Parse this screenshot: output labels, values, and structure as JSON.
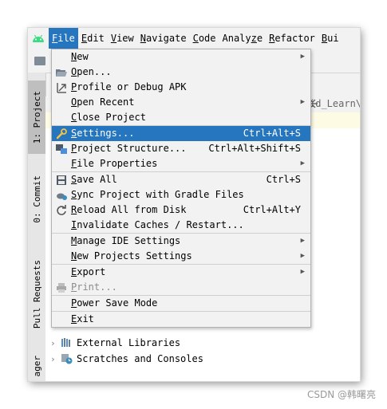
{
  "menubar": {
    "items": [
      {
        "label": "File",
        "mnemonic_index": 0
      },
      {
        "label": "Edit",
        "mnemonic_index": 0
      },
      {
        "label": "View",
        "mnemonic_index": 0
      },
      {
        "label": "Navigate",
        "mnemonic_index": 0
      },
      {
        "label": "Code",
        "mnemonic_index": 0
      },
      {
        "label": "Analyze",
        "mnemonic_index": 5
      },
      {
        "label": "Refactor",
        "mnemonic_index": 0
      },
      {
        "label": "Bui",
        "mnemonic_index": 0
      }
    ]
  },
  "toolstrip": {
    "project_tab": "1: Project",
    "commit_tab": "0: Commit",
    "pull_requests_tab": "Pull Requests",
    "manager_tab": "ager"
  },
  "pathbar": {
    "tail": "id_Learn\\"
  },
  "file_menu": {
    "groups": [
      [
        {
          "label": "New",
          "icon": "",
          "shortcut": "",
          "submenu": true
        },
        {
          "label": "Open...",
          "icon": "folder-open-icon",
          "shortcut": "",
          "submenu": false
        },
        {
          "label": "Profile or Debug APK",
          "icon": "apk-arrow-icon",
          "shortcut": "",
          "submenu": false
        },
        {
          "label": "Open Recent",
          "icon": "",
          "shortcut": "",
          "submenu": true
        },
        {
          "label": "Close Project",
          "icon": "",
          "shortcut": "",
          "submenu": false
        }
      ],
      [
        {
          "label": "Settings...",
          "icon": "wrench-icon",
          "shortcut": "Ctrl+Alt+S",
          "submenu": false,
          "selected": true
        },
        {
          "label": "Project Structure...",
          "icon": "project-structure-icon",
          "shortcut": "Ctrl+Alt+Shift+S",
          "submenu": false
        },
        {
          "label": "File Properties",
          "icon": "",
          "shortcut": "",
          "submenu": true
        }
      ],
      [
        {
          "label": "Save All",
          "icon": "save-icon",
          "shortcut": "Ctrl+S",
          "submenu": false
        },
        {
          "label": "Sync Project with Gradle Files",
          "icon": "gradle-sync-icon",
          "shortcut": "",
          "submenu": false
        },
        {
          "label": "Reload All from Disk",
          "icon": "reload-icon",
          "shortcut": "Ctrl+Alt+Y",
          "submenu": false
        },
        {
          "label": "Invalidate Caches / Restart...",
          "icon": "",
          "shortcut": "",
          "submenu": false
        }
      ],
      [
        {
          "label": "Manage IDE Settings",
          "icon": "",
          "shortcut": "",
          "submenu": true
        },
        {
          "label": "New Projects Settings",
          "icon": "",
          "shortcut": "",
          "submenu": true
        }
      ],
      [
        {
          "label": "Export",
          "icon": "",
          "shortcut": "",
          "submenu": true
        },
        {
          "label": "Print...",
          "icon": "print-icon",
          "shortcut": "",
          "submenu": false,
          "disabled": true
        }
      ],
      [
        {
          "label": "Power Save Mode",
          "icon": "",
          "shortcut": "",
          "submenu": false
        }
      ],
      [
        {
          "label": "Exit",
          "icon": "",
          "shortcut": "",
          "submenu": false
        }
      ]
    ]
  },
  "tree": {
    "items": [
      {
        "label": "External Libraries",
        "icon": "library-icon"
      },
      {
        "label": "Scratches and Consoles",
        "icon": "scratches-icon"
      }
    ]
  },
  "watermark": "CSDN @韩曙亮",
  "colors": {
    "selection": "#2675bf",
    "menu_bg": "#f2f2f2"
  }
}
